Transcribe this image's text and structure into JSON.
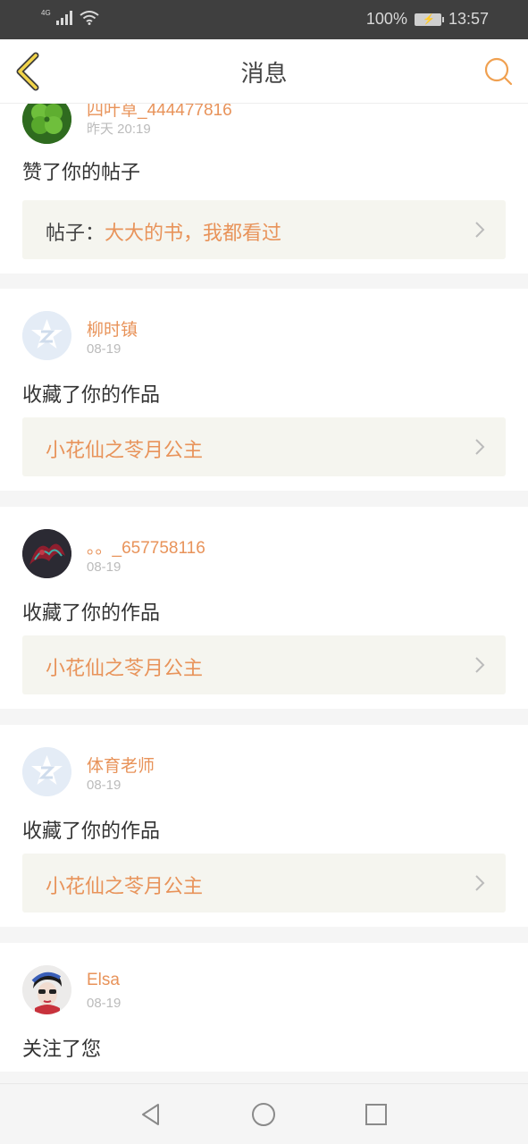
{
  "status": {
    "network": "4G",
    "battery": "100%",
    "time": "13:57"
  },
  "header": {
    "title": "消息",
    "back_icon": "chevron-left-icon",
    "search_icon": "search-icon",
    "accent": "#f0a050"
  },
  "colors": {
    "username": "#e8935a",
    "ref_bg": "#f5f5ef"
  },
  "messages": [
    {
      "user": "四叶草_444477816",
      "time": "昨天 20:19",
      "action": "赞了你的帖子",
      "ref_prefix": "帖子：",
      "ref_title": "大大的书，我都看过",
      "avatar": "clover-avatar"
    },
    {
      "user": "柳时镇",
      "time": "08-19",
      "action": "收藏了你的作品",
      "ref_prefix": "",
      "ref_title": "小花仙之苓月公主",
      "avatar": "default-avatar"
    },
    {
      "user": "。。_657758116",
      "time": "08-19",
      "action": "收藏了你的作品",
      "ref_prefix": "",
      "ref_title": "小花仙之苓月公主",
      "avatar": "dragon-avatar"
    },
    {
      "user": "体育老师",
      "time": "08-19",
      "action": "收藏了你的作品",
      "ref_prefix": "",
      "ref_title": "小花仙之苓月公主",
      "avatar": "default-avatar"
    },
    {
      "user": "Elsa",
      "time": "08-19",
      "action": "关注了您",
      "avatar": "girl-avatar"
    }
  ]
}
